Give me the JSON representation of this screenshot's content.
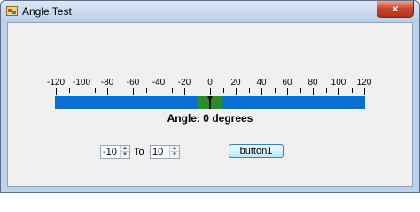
{
  "window": {
    "title": "Angle Test",
    "close_glyph": "×"
  },
  "ruler": {
    "min": -120,
    "max": 120,
    "major_step": 20,
    "minor_step": 10,
    "tick_labels": [
      "-120",
      "-100",
      "-80",
      "-60",
      "-40",
      "-20",
      "0",
      "20",
      "40",
      "60",
      "80",
      "100",
      "120"
    ],
    "current_value": 0,
    "highlight_range": [
      -10,
      10
    ],
    "bar_color": "#0a6fd1",
    "highlight_color": "#2f8a2f"
  },
  "angle_text": "Angle: 0 degrees",
  "controls": {
    "from_value": "-10",
    "to_label": "To",
    "to_value": "10",
    "button_label": "button1"
  },
  "icons": {
    "app": "app-window-icon",
    "spin_up": "▲",
    "spin_down": "▼"
  }
}
